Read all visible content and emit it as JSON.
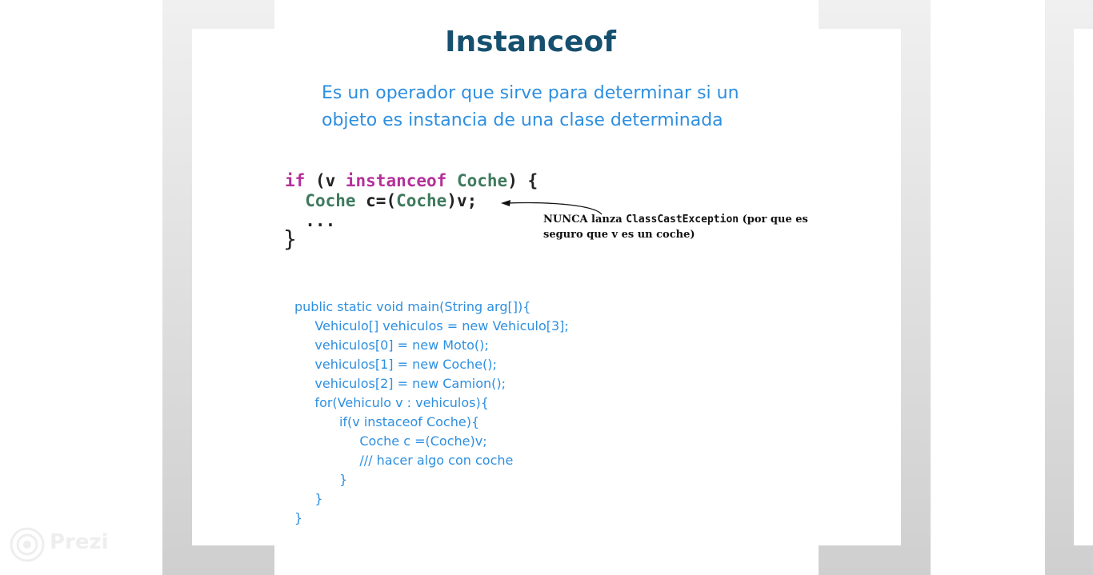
{
  "slide": {
    "title": "Instanceof",
    "subtitle_lines": [
      "Es un operador  que sirve para determinar si un",
      "objeto es instancia de una clase determinada"
    ]
  },
  "code_image": {
    "line1": {
      "if": "if",
      "paren_open": " (v ",
      "instanceof": "instanceof",
      "space": " ",
      "class": "Coche",
      "close": ") {"
    },
    "line2": {
      "indent": "  ",
      "class1": "Coche",
      "mid": " c=(",
      "class2": "Coche",
      "end": ")v;"
    },
    "line3": "  ...",
    "line4": "}",
    "note_line1_a": "NUNCA lanza ",
    "note_line1_mono": "ClassCastException",
    "note_line1_b": " (por que es",
    "note_line2": "seguro que v es un coche)"
  },
  "java_code": [
    "public static void main(String arg[]){",
    "     Vehiculo[] vehiculos = new Vehiculo[3];",
    "     vehiculos[0] = new Moto();",
    "     vehiculos[1] = new Coche();",
    "     vehiculos[2] = new Camion();",
    "     for(Vehiculo v : vehiculos){",
    "           if(v instaceof Coche){",
    "                Coche c =(Coche)v;",
    "                /// hacer algo con coche",
    "           }",
    "     }",
    "}"
  ],
  "branding": {
    "logo_text": "Prezi"
  },
  "colors": {
    "title": "#16506e",
    "text": "#2e8fe0",
    "keyword": "#b5309a",
    "class_name": "#3f7a5d"
  }
}
